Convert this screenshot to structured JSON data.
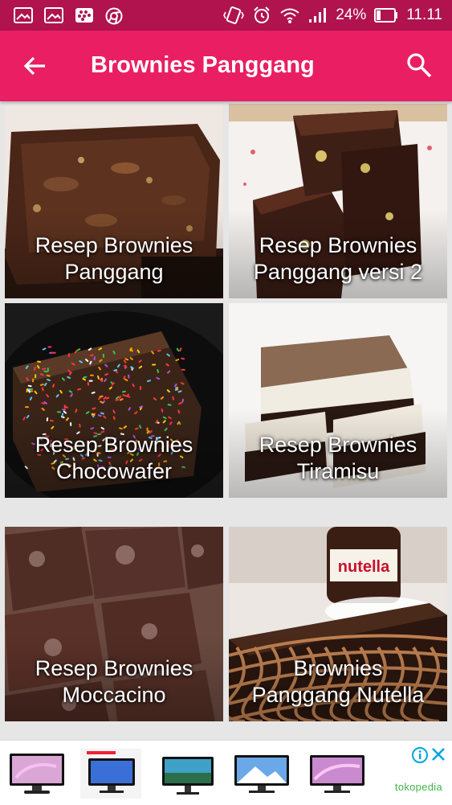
{
  "status_bar": {
    "left_icons": [
      "image-icon",
      "image-icon",
      "bbm-icon",
      "chrome-icon"
    ],
    "right_icons": [
      "vibrate-icon",
      "alarm-icon",
      "wifi-icon",
      "signal-icon"
    ],
    "battery_percent": "24%",
    "battery_level": 0.24,
    "time": "11.11"
  },
  "app_bar": {
    "title": "Brownies Panggang",
    "back_icon": "arrow-back-icon",
    "search_icon": "search-icon",
    "color": "#e91e63",
    "status_color": "#b0134d"
  },
  "recipes": [
    {
      "line1": "Resep Brownies",
      "line2": "Panggang"
    },
    {
      "line1": "Resep Brownies",
      "line2": "Panggang versi 2"
    },
    {
      "line1": "Resep Brownies",
      "line2": "Chocowafer"
    },
    {
      "line1": "Resep Brownies",
      "line2": "Tiramisu"
    },
    {
      "line1": "Resep Brownies",
      "line2": "Moccacino"
    },
    {
      "line1": "Brownies",
      "line2": "Panggang Nutella"
    }
  ],
  "ad": {
    "brand": "tokopedia",
    "info_icon": "info-icon",
    "close_icon": "close-icon",
    "product_icons": [
      "monitor-icon",
      "monitor-icon",
      "monitor-icon",
      "monitor-icon",
      "monitor-icon"
    ],
    "brand_color": "#42b549"
  }
}
